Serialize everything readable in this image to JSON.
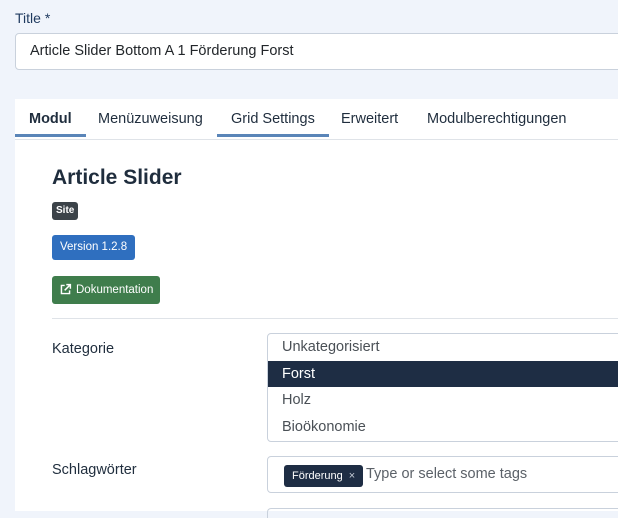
{
  "title_field": {
    "label": "Title *",
    "value": "Article Slider Bottom A 1 Förderung Forst"
  },
  "tabs": [
    {
      "label": "Modul"
    },
    {
      "label": "Menüzuweisung"
    },
    {
      "label": "Grid Settings"
    },
    {
      "label": "Erweitert"
    },
    {
      "label": "Modulberechtigungen"
    }
  ],
  "module": {
    "name": "Article Slider",
    "badge": "Site",
    "version_label": "Version 1.2.8",
    "doc_label": "Dokumentation"
  },
  "kategorie": {
    "label": "Kategorie",
    "options": [
      "Unkategorisiert",
      "Forst",
      "Holz",
      "Bioökonomie"
    ],
    "selected": "Forst"
  },
  "schlagwoerter": {
    "label": "Schlagwörter",
    "tags": [
      "Förderung"
    ],
    "remove_glyph": "×",
    "placeholder": "Type or select some tags"
  },
  "colors": {
    "accent": "#5a85b8",
    "selected_bg": "#1e2d44",
    "version_btn": "#2f6fbf",
    "doc_btn": "#3f7d4c"
  }
}
